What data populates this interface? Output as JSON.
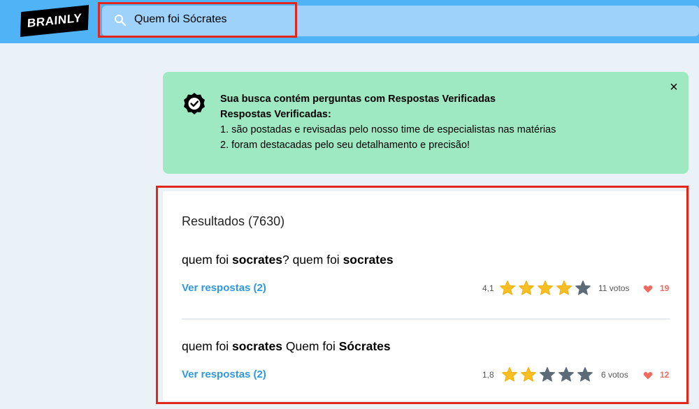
{
  "header": {
    "logo_text": "BRAINLY",
    "search_value": "Quem foi Sócrates",
    "accent_color": "#4fb3f6"
  },
  "notice": {
    "line1": "Sua busca contém perguntas com Respostas Verificadas",
    "line2": "Respostas Verificadas:",
    "line3": "1. são postadas e revisadas pelo nosso time de especialistas nas matérias",
    "line4": "2. foram destacadas pelo seu detalhamento e precisão!",
    "close_icon": "close-icon",
    "background_color": "#9ee9c1"
  },
  "results": {
    "title": "Resultados (7630)",
    "items": [
      {
        "q_parts": [
          "quem foi ",
          "socrates",
          "? quem foi ",
          "socrates"
        ],
        "link": "Ver respostas (2)",
        "rating": "4,1",
        "stars_filled": 4,
        "votes": "11 votos",
        "likes": "19"
      },
      {
        "q_parts": [
          "quem foi ",
          "socrates",
          " Quem foi ",
          "Sócrates"
        ],
        "link": "Ver respostas (2)",
        "rating": "1,8",
        "stars_filled": 2,
        "votes": "6 votos",
        "likes": "12"
      }
    ]
  }
}
